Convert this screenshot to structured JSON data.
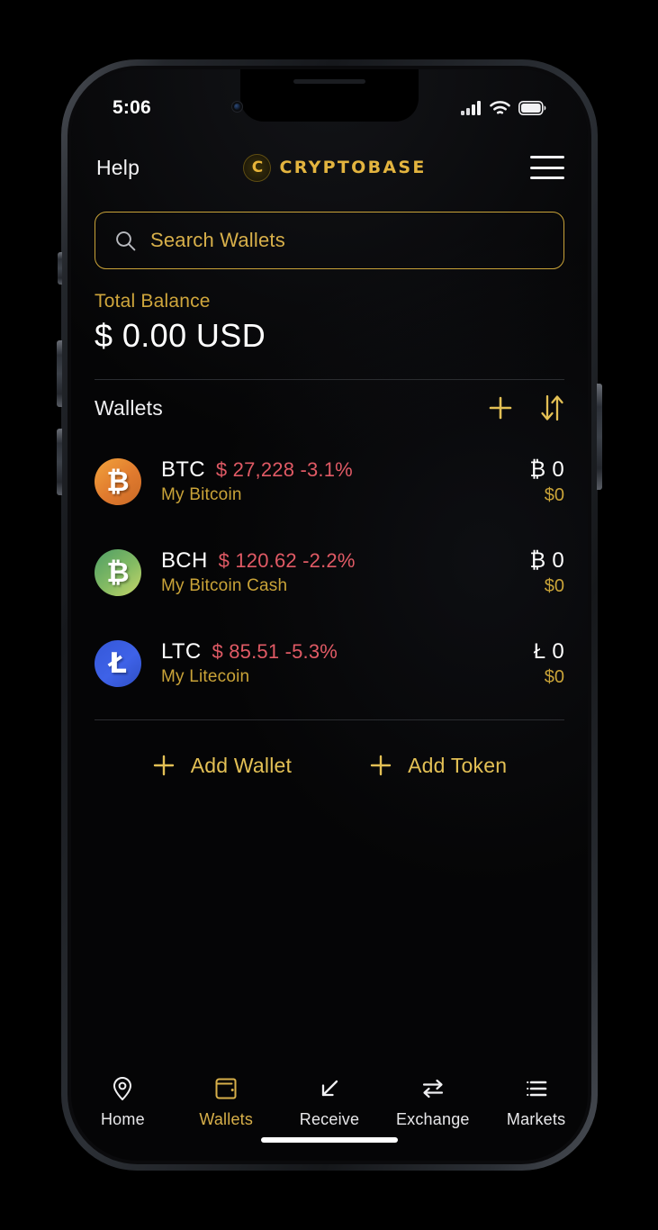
{
  "statusbar": {
    "time": "5:06",
    "icons": {
      "signal": "cellular-signal-icon",
      "wifi": "wifi-icon",
      "battery": "battery-icon"
    }
  },
  "header": {
    "help_label": "Help",
    "brand_name": "CRYPTOBASE",
    "brand_mark": "C",
    "menu_icon": "hamburger-menu-icon"
  },
  "search": {
    "placeholder": "Search Wallets",
    "icon": "search-icon"
  },
  "balance": {
    "label": "Total Balance",
    "value": "$ 0.00 USD"
  },
  "wallets_section": {
    "title": "Wallets",
    "add_icon": "plus-icon",
    "sort_icon": "sort-arrows-icon"
  },
  "wallets": [
    {
      "symbol": "BTC",
      "price": "$ 27,228 -3.1%",
      "name": "My Bitcoin",
      "amount": "₿ 0",
      "fiat": "$0",
      "glyph": "₿",
      "icon": "bitcoin-icon"
    },
    {
      "symbol": "BCH",
      "price": "$ 120.62 -2.2%",
      "name": "My Bitcoin Cash",
      "amount": "₿ 0",
      "fiat": "$0",
      "glyph": "₿",
      "icon": "bitcoin-cash-icon"
    },
    {
      "symbol": "LTC",
      "price": "$ 85.51 -5.3%",
      "name": "My Litecoin",
      "amount": "Ł 0",
      "fiat": "$0",
      "glyph": "Ł",
      "icon": "litecoin-icon"
    }
  ],
  "actions": {
    "add_wallet": "Add Wallet",
    "add_token": "Add Token"
  },
  "tabs": [
    {
      "label": "Home",
      "icon": "location-pin-icon",
      "active": false
    },
    {
      "label": "Wallets",
      "icon": "wallet-icon",
      "active": true
    },
    {
      "label": "Receive",
      "icon": "arrow-down-left-icon",
      "active": false
    },
    {
      "label": "Exchange",
      "icon": "swap-arrows-icon",
      "active": false
    },
    {
      "label": "Markets",
      "icon": "list-icon",
      "active": false
    }
  ],
  "colors": {
    "gold": "#d8b04a",
    "gold_dim": "#c9a338",
    "down_red": "#e05a65",
    "background": "#050506"
  }
}
